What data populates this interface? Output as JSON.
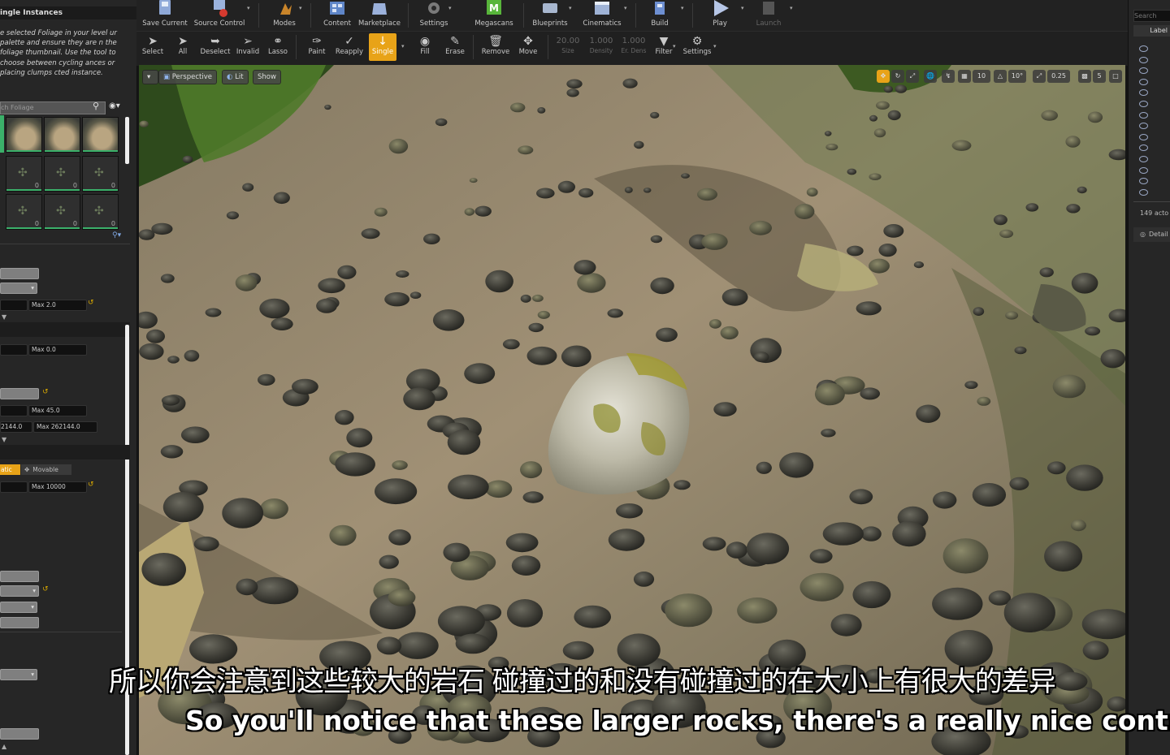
{
  "left_panel": {
    "title": "ingle Instances",
    "help_text": "e selected Foliage in your level ur palette and ensure they are n the foliage thumbnail. Use the tool to choose between cycling ances or placing clumps cted instance.",
    "search_placeholder": "ch Foliage",
    "thumb_counts": [
      "0",
      "0",
      "0",
      "0",
      "0",
      "0"
    ],
    "fields": {
      "max1": "Max  2.0",
      "max2": "Max  0.0",
      "max3": "Max  45.0",
      "min4": "2144.0",
      "max4": "Max  262144.0",
      "mobility_static": "atic",
      "mobility_movable": "Movable",
      "max5": "Max  10000"
    }
  },
  "toolbar_top": {
    "buttons": [
      "Save Current",
      "Source Control",
      "Modes",
      "Content",
      "Marketplace",
      "Settings",
      "Megascans",
      "Blueprints",
      "Cinematics",
      "Build",
      "Play",
      "Launch"
    ]
  },
  "toolbar_bottom": {
    "tools": [
      "Select",
      "All",
      "Deselect",
      "Invalid",
      "Lasso",
      "Paint",
      "Reapply",
      "Single",
      "Fill",
      "Erase",
      "Remove",
      "Move"
    ],
    "values": [
      "20.00",
      "1.000",
      "1.000"
    ],
    "value_labels": [
      "Size",
      "Density",
      "Er. Dens"
    ],
    "filter_label": "Filter",
    "settings_label": "Settings"
  },
  "viewport": {
    "view_mode": "Perspective",
    "lighting_mode": "Lit",
    "show_label": "Show",
    "grid_snap": "10",
    "rotation_snap": "10°",
    "scale_snap": "0.25",
    "camera_speed": "5"
  },
  "right_panel": {
    "search_placeholder": "Search",
    "label_header": "Label",
    "actor_count": "149 acto",
    "details_tab": "Detail"
  },
  "subtitles": {
    "chinese": "所以你会注意到这些较大的岩石 碰撞过的和没有碰撞过的在大小上有很大的差异",
    "english": "So you'll notice that these larger rocks, there's a really nice contrast"
  },
  "colors": {
    "active_tool": "#e8a318",
    "megascans_green": "#58b53b",
    "panel_bg": "#262626"
  }
}
